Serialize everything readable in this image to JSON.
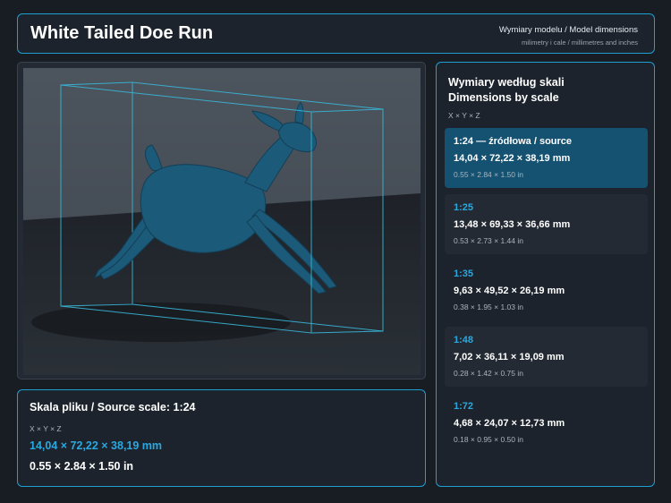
{
  "header": {
    "title": "White Tailed Doe Run",
    "subtitle": "Wymiary modelu / Model dimensions",
    "caption": "milimetry i cale / millimetres and inches"
  },
  "source_scale": {
    "title": "Skala pliku / Source scale: 1:24",
    "axes": "X × Y × Z",
    "mm": "14,04 × 72,22 × 38,19 mm",
    "inches": "0.55 × 2.84 × 1.50 in"
  },
  "scales_panel": {
    "title_line1": "Wymiary według skali",
    "title_line2": "Dimensions by scale",
    "axes": "X × Y × Z",
    "items": [
      {
        "label": "1:24  —  źródłowa / source",
        "mm": "14,04 × 72,22 × 38,19 mm",
        "inches": "0.55 × 2.84 × 1.50 in",
        "active": true
      },
      {
        "label": "1:25",
        "mm": "13,48 × 69,33 × 36,66 mm",
        "inches": "0.53 × 2.73 × 1.44 in",
        "active": false
      },
      {
        "label": "1:35",
        "mm": "9,63 × 49,52 × 26,19 mm",
        "inches": "0.38 × 1.95 × 1.03 in",
        "active": false
      },
      {
        "label": "1:48",
        "mm": "7,02 × 36,11 × 19,09 mm",
        "inches": "0.28 × 1.42 × 0.75 in",
        "active": false
      },
      {
        "label": "1:72",
        "mm": "4,68 × 24,07 × 12,73 mm",
        "inches": "0.18 × 0.95 × 0.50 in",
        "active": false
      }
    ]
  },
  "colors": {
    "accent": "#1f9fd0",
    "model": "#1b5a78",
    "active_card": "#155272",
    "background": "#181d24"
  },
  "icons": {
    "model": "deer-model-icon"
  }
}
